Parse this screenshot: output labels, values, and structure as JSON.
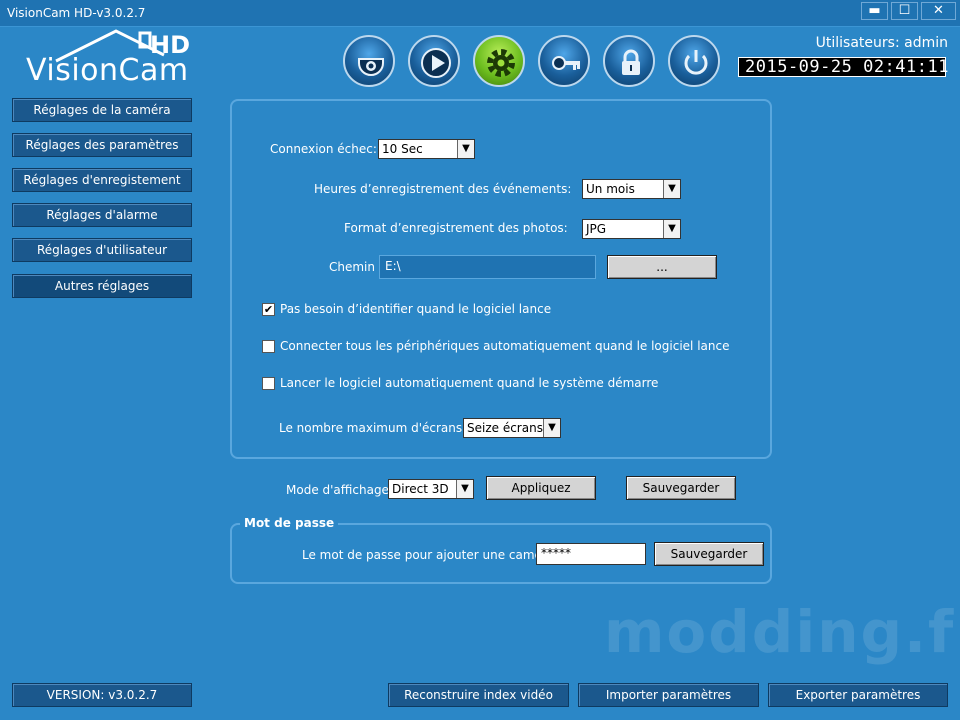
{
  "window": {
    "title": "VisionCam HD-v3.0.2.7",
    "controls": {
      "minimize": "▬",
      "maximize": "☐",
      "close": "✕"
    }
  },
  "header": {
    "logo_text": "VisionCam",
    "logo_hd": "HD",
    "users_label": "Utilisateurs: admin",
    "clock": "2015-09-25 02:41:11",
    "nav": [
      {
        "icon": "camera-dome-icon",
        "active": false
      },
      {
        "icon": "play-icon",
        "active": false
      },
      {
        "icon": "gear-icon",
        "active": true
      },
      {
        "icon": "key-icon",
        "active": false
      },
      {
        "icon": "lock-icon",
        "active": false
      },
      {
        "icon": "power-icon",
        "active": false
      }
    ]
  },
  "sidebar": {
    "items": [
      {
        "label": "Réglages de la caméra"
      },
      {
        "label": "Réglages des paramètres"
      },
      {
        "label": "Réglages d'enregistement"
      },
      {
        "label": "Réglages d'alarme"
      },
      {
        "label": "Réglages d'utilisateur"
      },
      {
        "label": "Autres réglages",
        "selected": true
      }
    ],
    "version": "VERSION: v3.0.2.7"
  },
  "settings": {
    "connection_fail_label": "Connexion échec:",
    "connection_fail_value": "10 Sec",
    "event_hours_label": "Heures d’enregistrement des événements:",
    "event_hours_value": "Un mois",
    "photo_format_label": "Format d’enregistrement des photos:",
    "photo_format_value": "JPG",
    "path_label": "Chemin",
    "path_value": "E:\\",
    "browse_label": "...",
    "checkboxes": [
      {
        "label": "Pas besoin d’identifier quand le logiciel lance",
        "checked": true
      },
      {
        "label": "Connecter tous les périphériques automatiquement quand le logiciel lance",
        "checked": false
      },
      {
        "label": "Lancer le logiciel automatiquement quand le système démarre",
        "checked": false
      }
    ],
    "max_screens_label": "Le nombre maximum d'écrans:",
    "max_screens_value": "Seize écrans"
  },
  "display": {
    "mode_label": "Mode d'affichage:",
    "mode_value": "Direct 3D",
    "apply_label": "Appliquez",
    "save_label": "Sauvegarder"
  },
  "password": {
    "section_title": "Mot de passe",
    "add_camera_label": "Le mot de passe pour ajouter une caméra",
    "value": "*****",
    "save_label": "Sauvegarder"
  },
  "footer": {
    "rebuild_label": "Reconstruire index vidéo",
    "import_label": "Importer paramètres",
    "export_label": "Exporter paramètres"
  },
  "watermark": "modding.fr"
}
